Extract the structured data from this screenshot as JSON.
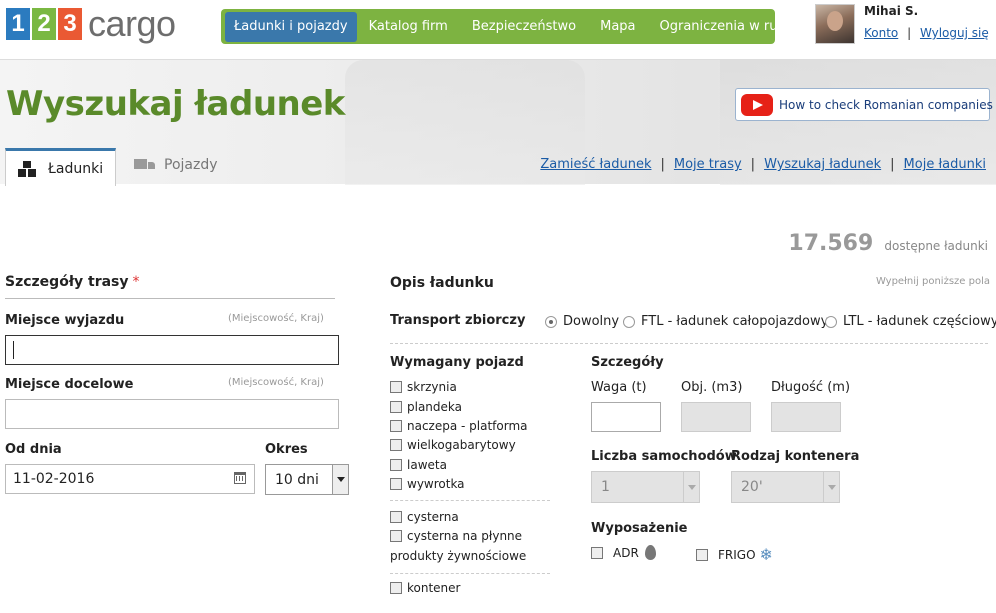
{
  "header": {
    "logo_digits": [
      "1",
      "2",
      "3"
    ],
    "logo_colors": [
      "#2b7bbf",
      "#7ab842",
      "#ea5933"
    ],
    "logo_word": "cargo",
    "nav": [
      {
        "label": "Ładunki i pojazdy",
        "active": true
      },
      {
        "label": "Katalog firm",
        "active": false
      },
      {
        "label": "Bezpieczeństwo",
        "active": false
      },
      {
        "label": "Mapa",
        "active": false
      },
      {
        "label": "Ograniczenia w ruchu",
        "active": false
      }
    ],
    "user": {
      "name": "Mihai S.",
      "account_link": "Konto",
      "separator": "|",
      "logout_link": "Wyloguj się"
    }
  },
  "page": {
    "title": "Wyszukaj ładunek",
    "promo": "How to check Romanian companies",
    "tabs": [
      {
        "label": "Ładunki",
        "active": true,
        "icon": "boxes-icon"
      },
      {
        "label": "Pojazdy",
        "active": false,
        "icon": "truck-icon"
      }
    ],
    "quick_links": [
      "Zamieść ładunek",
      "Moje trasy",
      "Wyszukaj ładunek",
      "Moje ładunki"
    ],
    "link_separator": "|",
    "counter": {
      "value": "17.569",
      "label": "dostępne ładunki"
    }
  },
  "route": {
    "heading": "Szczegóły trasy",
    "required_mark": "*",
    "departure": {
      "label": "Miejsce wyjazdu",
      "hint": "(Miejscowość, Kraj)",
      "value": ""
    },
    "destination": {
      "label": "Miejsce docelowe",
      "hint": "(Miejscowość, Kraj)",
      "value": ""
    },
    "date": {
      "label": "Od dnia",
      "value": "11-02-2016"
    },
    "period": {
      "label": "Okres",
      "value": "10 dni"
    }
  },
  "cargo": {
    "heading": "Opis ładunku",
    "hint": "Wypełnij poniższe pola",
    "transport": {
      "label": "Transport zbiorczy",
      "options": [
        {
          "label": "Dowolny",
          "selected": true
        },
        {
          "label": "FTL - ładunek całopojazdowy",
          "selected": false
        },
        {
          "label": "LTL - ładunek częściowy",
          "selected": false
        }
      ]
    },
    "vehicle": {
      "heading": "Wymagany pojazd",
      "group1": [
        "skrzynia",
        "plandeka",
        "naczepa - platforma",
        "wielkogabarytowy",
        "laweta",
        "wywrotka"
      ],
      "group2": [
        "cysterna",
        "cysterna na płynne"
      ],
      "group2_continuation": "produkty żywnościowe",
      "group3": [
        "kontener"
      ]
    },
    "details": {
      "heading": "Szczegóły",
      "weight_label": "Waga (t)",
      "volume_label": "Obj. (m3)",
      "length_label": "Długość (m)",
      "trucks_label": "Liczba samochodów",
      "trucks_value": "1",
      "container_label": "Rodzaj kontenera",
      "container_value": "20'"
    },
    "equipment": {
      "heading": "Wyposażenie",
      "adr": "ADR",
      "frigo": "FRIGO",
      "snow_glyph": "❄"
    }
  }
}
